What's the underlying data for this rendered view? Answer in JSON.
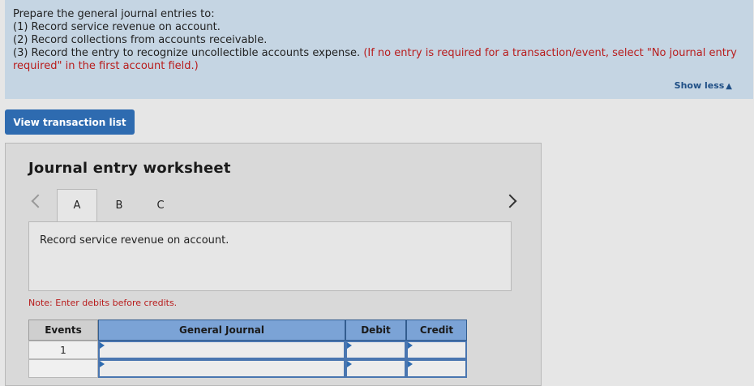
{
  "instructions": {
    "line1": "Prepare the general journal entries to:",
    "line2": "(1) Record service revenue on account.",
    "line3": "(2) Record collections from accounts receivable.",
    "line4": "(3) Record the entry to recognize uncollectible accounts expense.",
    "line4_note": "(If no entry is required for a transaction/event, select \"No journal entry required\" in the first account field.)",
    "show_less": "Show less",
    "show_less_icon": "triangle-up-icon"
  },
  "view_button": "View transaction list",
  "worksheet": {
    "title": "Journal entry worksheet",
    "tabs": [
      "A",
      "B",
      "C"
    ],
    "active_tab": "A",
    "description": "Record service revenue on account.",
    "note": "Note: Enter debits before credits.",
    "columns": {
      "events": "Events",
      "journal": "General Journal",
      "debit": "Debit",
      "credit": "Credit"
    },
    "rows": [
      {
        "event": "1",
        "journal": "",
        "debit": "",
        "credit": ""
      },
      {
        "event": "",
        "journal": "",
        "debit": "",
        "credit": ""
      }
    ]
  },
  "colors": {
    "instructions_bg": "#c5d5e3",
    "accent_button": "#2e6bb0",
    "header_blue": "#7ba3d6",
    "note_red": "#b81c1c"
  }
}
